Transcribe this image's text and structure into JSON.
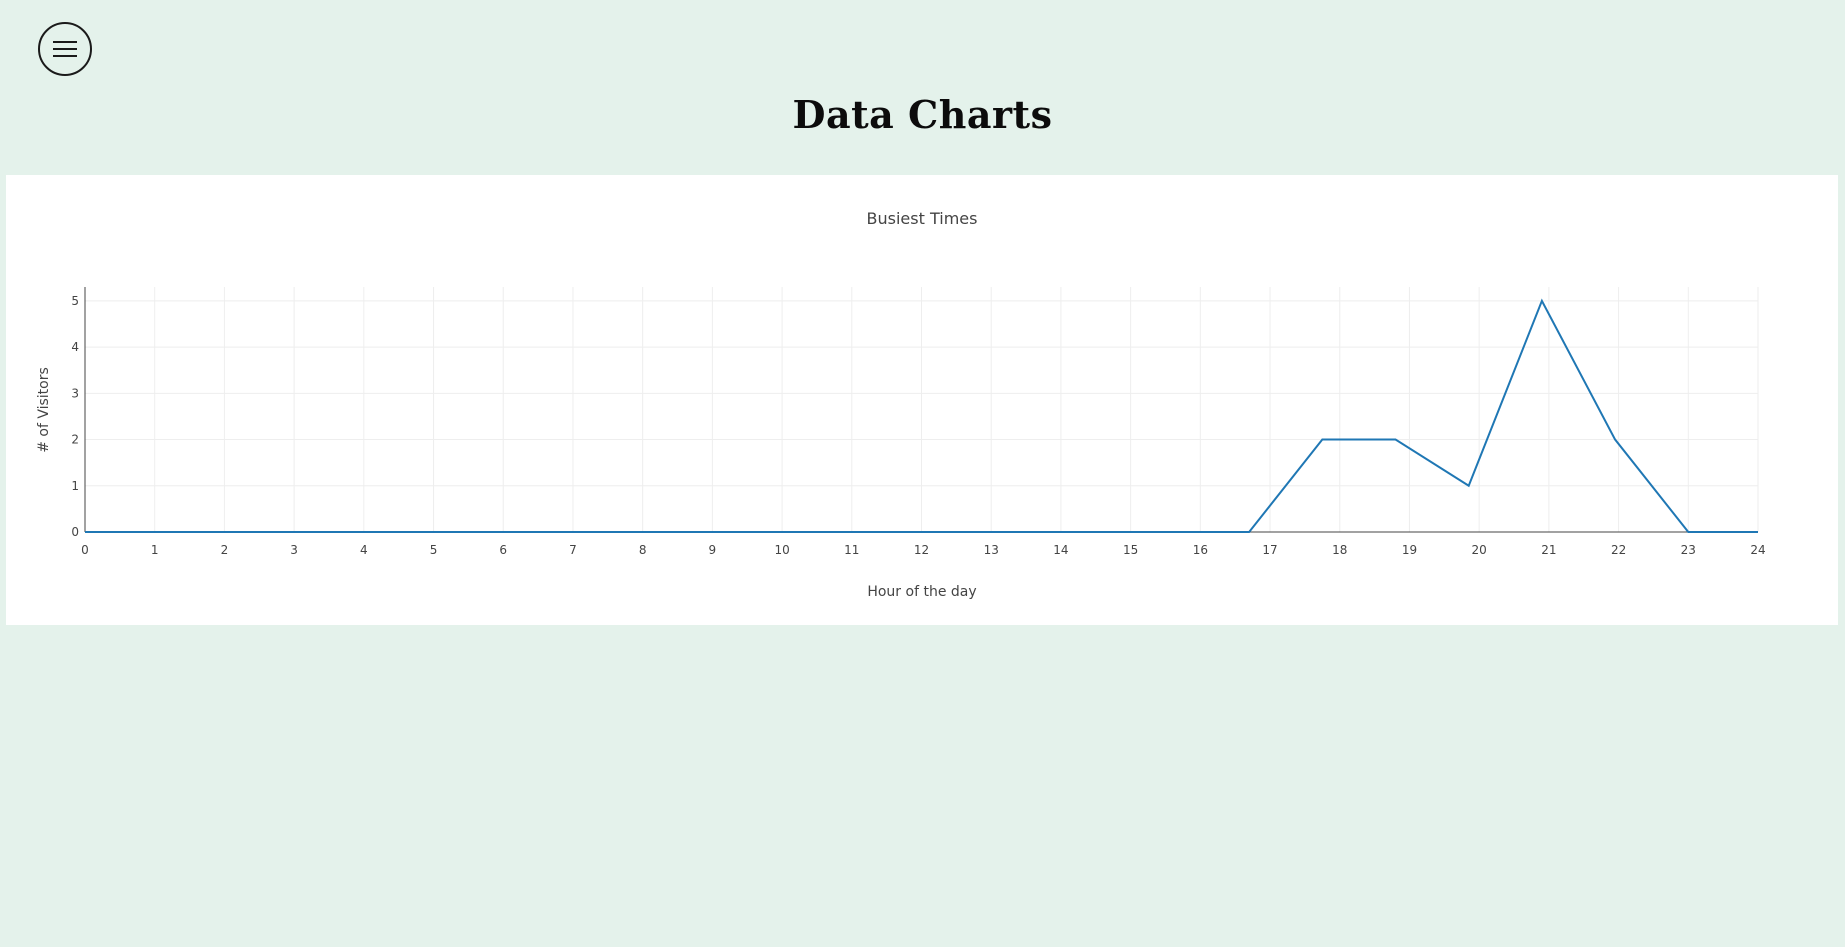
{
  "header": {
    "menu_icon": "hamburger-menu-icon",
    "title": "Data Charts"
  },
  "colors": {
    "background": "#e4f2eb",
    "card": "#ffffff",
    "line": "#1f77b4",
    "grid": "#eeeeee",
    "axis": "#444444"
  },
  "chart_data": {
    "type": "line",
    "title": "Busiest Times",
    "xlabel": "Hour of the day",
    "ylabel": "# of Visitors",
    "xlim": [
      0,
      24
    ],
    "ylim": [
      0,
      5
    ],
    "xticks": [
      0,
      1,
      2,
      3,
      4,
      5,
      6,
      7,
      8,
      9,
      10,
      11,
      12,
      13,
      14,
      15,
      16,
      17,
      18,
      19,
      20,
      21,
      22,
      23,
      24
    ],
    "yticks": [
      0,
      1,
      2,
      3,
      4,
      5
    ],
    "grid": true,
    "legend": false,
    "series": [
      {
        "x": [
          0,
          1,
          2,
          3,
          4,
          5,
          6,
          7,
          8,
          9,
          10,
          11,
          12,
          13,
          14,
          15,
          16,
          16.7,
          17.75,
          18.8,
          19.85,
          20.9,
          21.95,
          23,
          24
        ],
        "y": [
          0,
          0,
          0,
          0,
          0,
          0,
          0,
          0,
          0,
          0,
          0,
          0,
          0,
          0,
          0,
          0,
          0,
          0,
          2,
          2,
          1,
          5,
          2,
          0,
          0
        ]
      }
    ]
  }
}
